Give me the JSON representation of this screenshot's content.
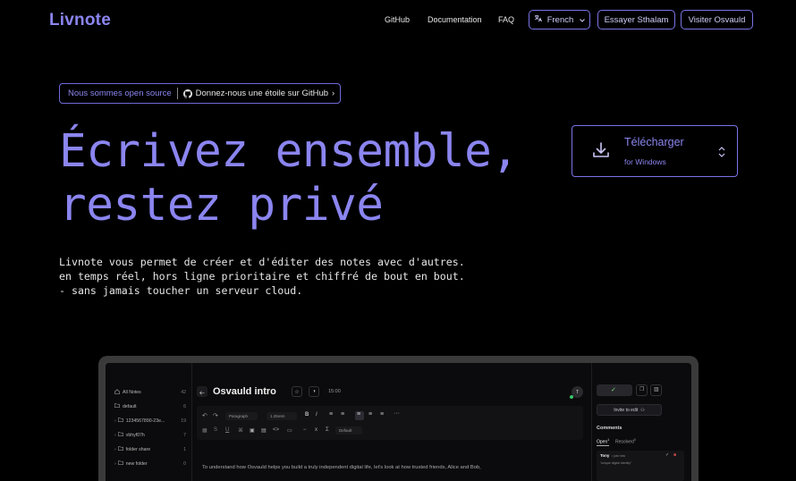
{
  "header": {
    "logo": "Livnote",
    "nav": [
      "GitHub",
      "Documentation",
      "FAQ"
    ],
    "language": "French",
    "try_button": "Essayer Sthalam",
    "visit_button": "Visiter Osvauld"
  },
  "badge": {
    "open_source": "Nous sommes open source",
    "star": "Donnez-nous une étoile sur GitHub",
    "chevron": "›"
  },
  "hero": {
    "title_line1": "Écrivez ensemble,",
    "title_line2": "restez privé",
    "description": "Livnote vous permet de créer et d'éditer des notes avec d'autres.\nen temps réel, hors ligne prioritaire et chiffré de bout en bout.\n- sans jamais toucher un serveur cloud."
  },
  "download": {
    "title": "Télécharger",
    "subtitle": "for Windows"
  },
  "app": {
    "sidebar": [
      {
        "label": "All Notes",
        "count": "42"
      },
      {
        "label": "default",
        "count": "6"
      },
      {
        "label": "1234567890-23e...",
        "count": "19"
      },
      {
        "label": "vbhyf07h",
        "count": "7"
      },
      {
        "label": "folder share",
        "count": "1"
      },
      {
        "label": "new folder",
        "count": "0"
      }
    ],
    "note_title": "Osvauld intro",
    "time": "15:00",
    "avatar": "T",
    "toolbar": {
      "paragraph": "Paragraph",
      "size": "1.25rem",
      "default": "Default"
    },
    "editor_text": "To understand how Osvauld helps you build a truly independent digital life, let's look at how trusted friends, Alice and Bob,",
    "invite": "Invite to edit",
    "comments": {
      "title": "Comments",
      "open": "Open",
      "open_count": "1",
      "resolved": "Resolved",
      "resolved_count": "0",
      "user": "Tony",
      "time": "• just now",
      "quote": "\"unique digital identity\""
    }
  }
}
